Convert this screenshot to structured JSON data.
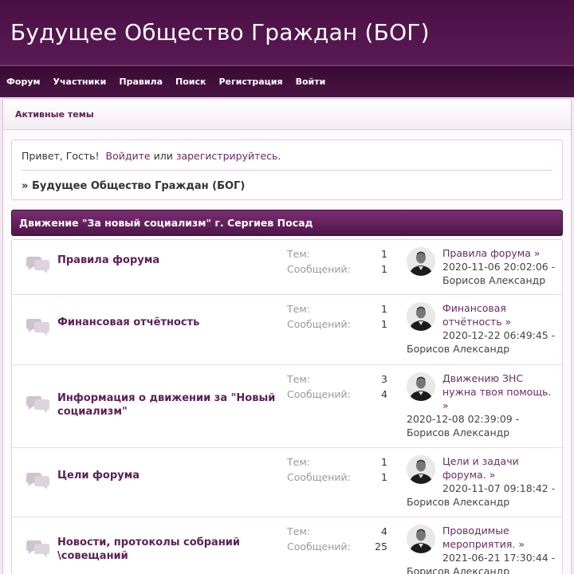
{
  "site": {
    "title": "Будущее Общество Граждан (БОГ)"
  },
  "nav": [
    "Форум",
    "Участники",
    "Правила",
    "Поиск",
    "Регистрация",
    "Войти"
  ],
  "breadcrumb": {
    "active_topics": "Активные темы"
  },
  "welcome": {
    "greeting": "Привет, Гость!",
    "login_link": "Войдите",
    "or": "или",
    "register_link": "зарегистрируйтесь",
    "path_prefix": "»",
    "forum_name": "Будущее Общество Граждан (БОГ)"
  },
  "category": {
    "title": "Движение \"За новый социализм\" г. Сергиев Посад"
  },
  "labels": {
    "topics": "Тем:",
    "posts": "Сообщений:"
  },
  "boards": [
    {
      "name": "Правила форума",
      "topics": "1",
      "posts": "1",
      "last_title": "Правила форума",
      "last_date": "2020-11-06 20:02:06 -",
      "last_author": "Борисов Александр"
    },
    {
      "name": "Финансовая отчётность",
      "topics": "1",
      "posts": "1",
      "last_title": "Финансовая отчётность",
      "last_date": "2020-12-22 06:49:45 -",
      "last_author": "Борисов Александр"
    },
    {
      "name": "Информация о движении за \"Новый социализм\"",
      "topics": "3",
      "posts": "4",
      "last_title": "Движению ЗНС нужна твоя помощь.",
      "last_date": "2020-12-08 02:39:09 -",
      "last_author": "Борисов Александр"
    },
    {
      "name": "Цели форума",
      "topics": "1",
      "posts": "1",
      "last_title": "Цели и задачи форума.",
      "last_date": "2020-11-07 09:18:42 -",
      "last_author": "Борисов Александр"
    },
    {
      "name": "Новости, протоколы собраний \\совещаний",
      "topics": "4",
      "posts": "25",
      "last_title": "Проводимые мероприятия.",
      "last_date": "2021-06-21 17:30:44 -",
      "last_author": "Борисов Александр"
    }
  ]
}
